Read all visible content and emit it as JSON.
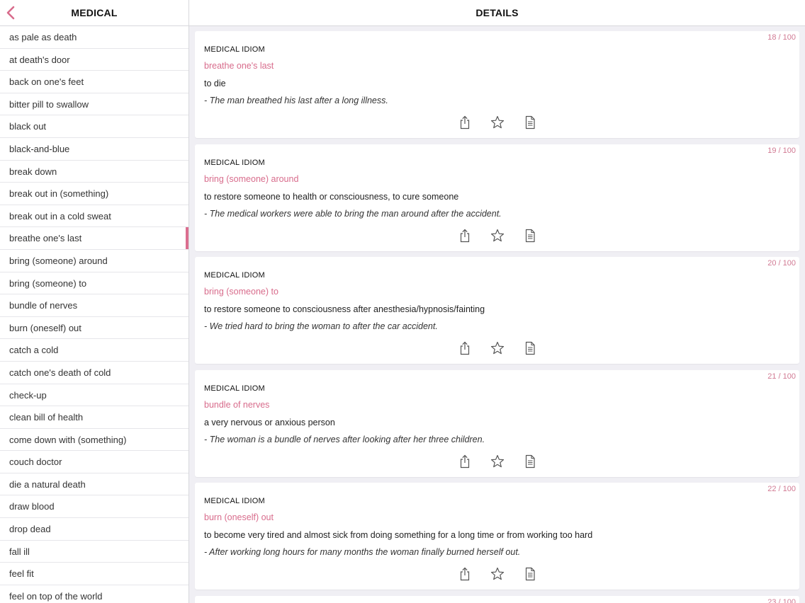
{
  "sidebar": {
    "title": "MEDICAL",
    "back_icon": "chevron-left-icon",
    "items": [
      {
        "label": "as pale as death"
      },
      {
        "label": "at death's door"
      },
      {
        "label": "back on one's feet"
      },
      {
        "label": "bitter pill to swallow"
      },
      {
        "label": "black out"
      },
      {
        "label": "black-and-blue"
      },
      {
        "label": "break down"
      },
      {
        "label": "break out in (something)"
      },
      {
        "label": "break out in a cold sweat"
      },
      {
        "label": "breathe one's last"
      },
      {
        "label": "bring (someone) around"
      },
      {
        "label": "bring (someone) to"
      },
      {
        "label": "bundle of nerves"
      },
      {
        "label": "burn (oneself) out"
      },
      {
        "label": "catch a cold"
      },
      {
        "label": "catch one's death of cold"
      },
      {
        "label": "check-up"
      },
      {
        "label": "clean bill of health"
      },
      {
        "label": "come down with (something)"
      },
      {
        "label": "couch doctor"
      },
      {
        "label": "die a natural death"
      },
      {
        "label": "draw blood"
      },
      {
        "label": "drop dead"
      },
      {
        "label": "fall ill"
      },
      {
        "label": "feel fit"
      },
      {
        "label": "feel on top of the world"
      }
    ],
    "selected_index": 9
  },
  "detail": {
    "title": "DETAILS",
    "cards": [
      {
        "counter": "18 / 100",
        "category": "MEDICAL IDIOM",
        "idiom": "breathe one's last",
        "definition": "to die",
        "example": "- The man breathed his last after a long illness."
      },
      {
        "counter": "19 / 100",
        "category": "MEDICAL IDIOM",
        "idiom": "bring (someone) around",
        "definition": "to restore someone to health or consciousness, to cure someone",
        "example": "- The medical workers were able to bring the man around after the accident."
      },
      {
        "counter": "20 / 100",
        "category": "MEDICAL IDIOM",
        "idiom": "bring (someone) to",
        "definition": "to restore someone to consciousness after anesthesia/hypnosis/fainting",
        "example": "- We tried hard to bring the woman to after the car accident."
      },
      {
        "counter": "21 / 100",
        "category": "MEDICAL IDIOM",
        "idiom": "bundle of nerves",
        "definition": "a very nervous or anxious person",
        "example": "- The woman is a bundle of nerves after looking after her three children."
      },
      {
        "counter": "22 / 100",
        "category": "MEDICAL IDIOM",
        "idiom": "burn (oneself) out",
        "definition": "to become very tired and almost sick from doing something for a long time or from working too hard",
        "example": "- After working long hours for many months the woman finally burned herself out."
      }
    ],
    "partial_card": {
      "counter": "23 / 100"
    },
    "action_icons": [
      "share-icon",
      "star-icon",
      "document-icon"
    ]
  },
  "colors": {
    "accent": "#d86c8c",
    "counter": "#d17a93",
    "background": "#f0eff4"
  }
}
